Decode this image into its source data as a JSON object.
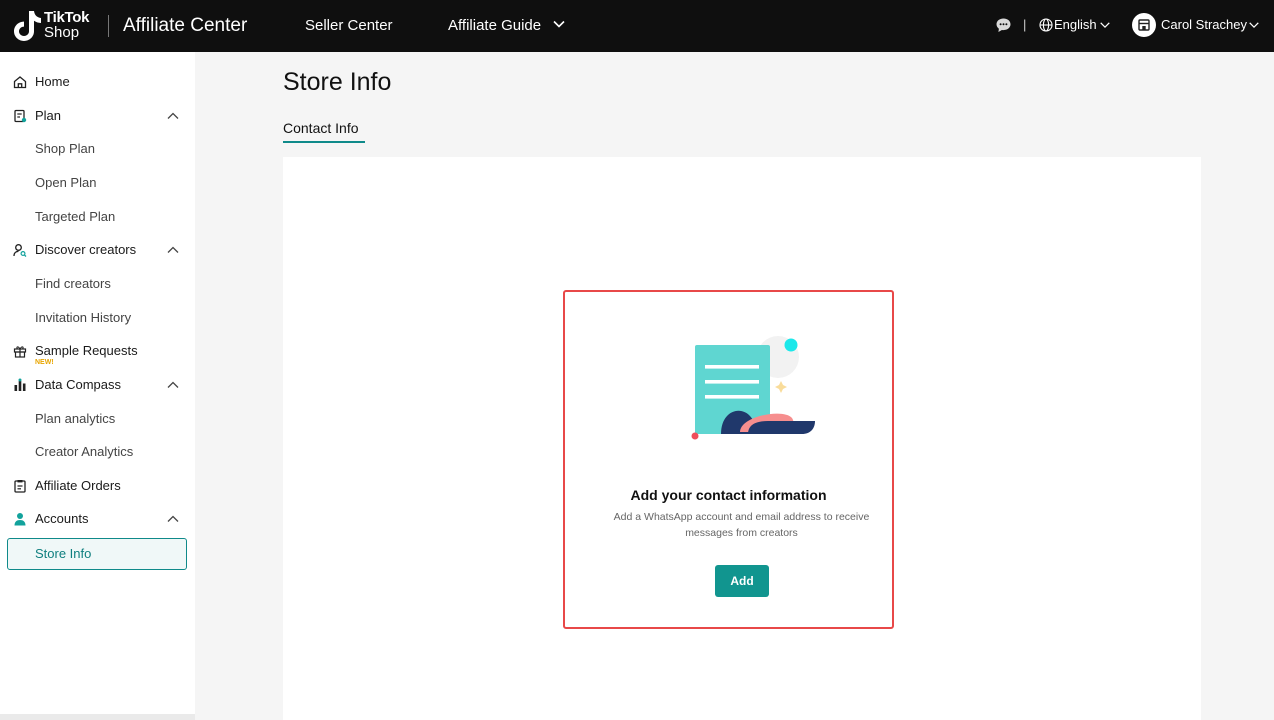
{
  "header": {
    "logo_line1": "TikTok",
    "logo_line2": "Shop",
    "app_title": "Affiliate Center",
    "nav": [
      {
        "label": "Seller Center"
      },
      {
        "label": "Affiliate Guide"
      }
    ],
    "separator": "|",
    "language": "English",
    "user_name": "Carol Strachey",
    "icons": {
      "message": "chat-bubble-icon",
      "language": "globe-icon",
      "store": "storefront-icon",
      "dropdown": "chevron-down-icon"
    }
  },
  "sidebar": {
    "items": [
      {
        "label": "Home",
        "icon": "home-icon"
      },
      {
        "label": "Plan",
        "icon": "plan-icon",
        "expanded": true
      },
      {
        "label": "Shop Plan"
      },
      {
        "label": "Open Plan"
      },
      {
        "label": "Targeted Plan"
      },
      {
        "label": "Discover creators",
        "icon": "person-search-icon",
        "expanded": true
      },
      {
        "label": "Find creators"
      },
      {
        "label": "Invitation History"
      },
      {
        "label": "Sample Requests",
        "icon": "gift-icon",
        "badge": "NEW!"
      },
      {
        "label": "Data Compass",
        "icon": "bar-chart-icon",
        "expanded": true
      },
      {
        "label": "Plan analytics"
      },
      {
        "label": "Creator Analytics"
      },
      {
        "label": "Affiliate Orders",
        "icon": "clipboard-icon"
      },
      {
        "label": "Accounts",
        "icon": "person-icon",
        "expanded": true
      },
      {
        "label": "Store Info",
        "active": true
      }
    ]
  },
  "main": {
    "title": "Store Info",
    "tabs": [
      {
        "label": "Contact Info",
        "active": true
      }
    ],
    "empty_state": {
      "title": "Add your contact information",
      "description": "Add a WhatsApp account and email address to receive messages from creators",
      "button_label": "Add"
    }
  },
  "colors": {
    "accent": "#11958f",
    "highlight_border": "#e84848",
    "topbar_bg": "#0f0f0f"
  }
}
